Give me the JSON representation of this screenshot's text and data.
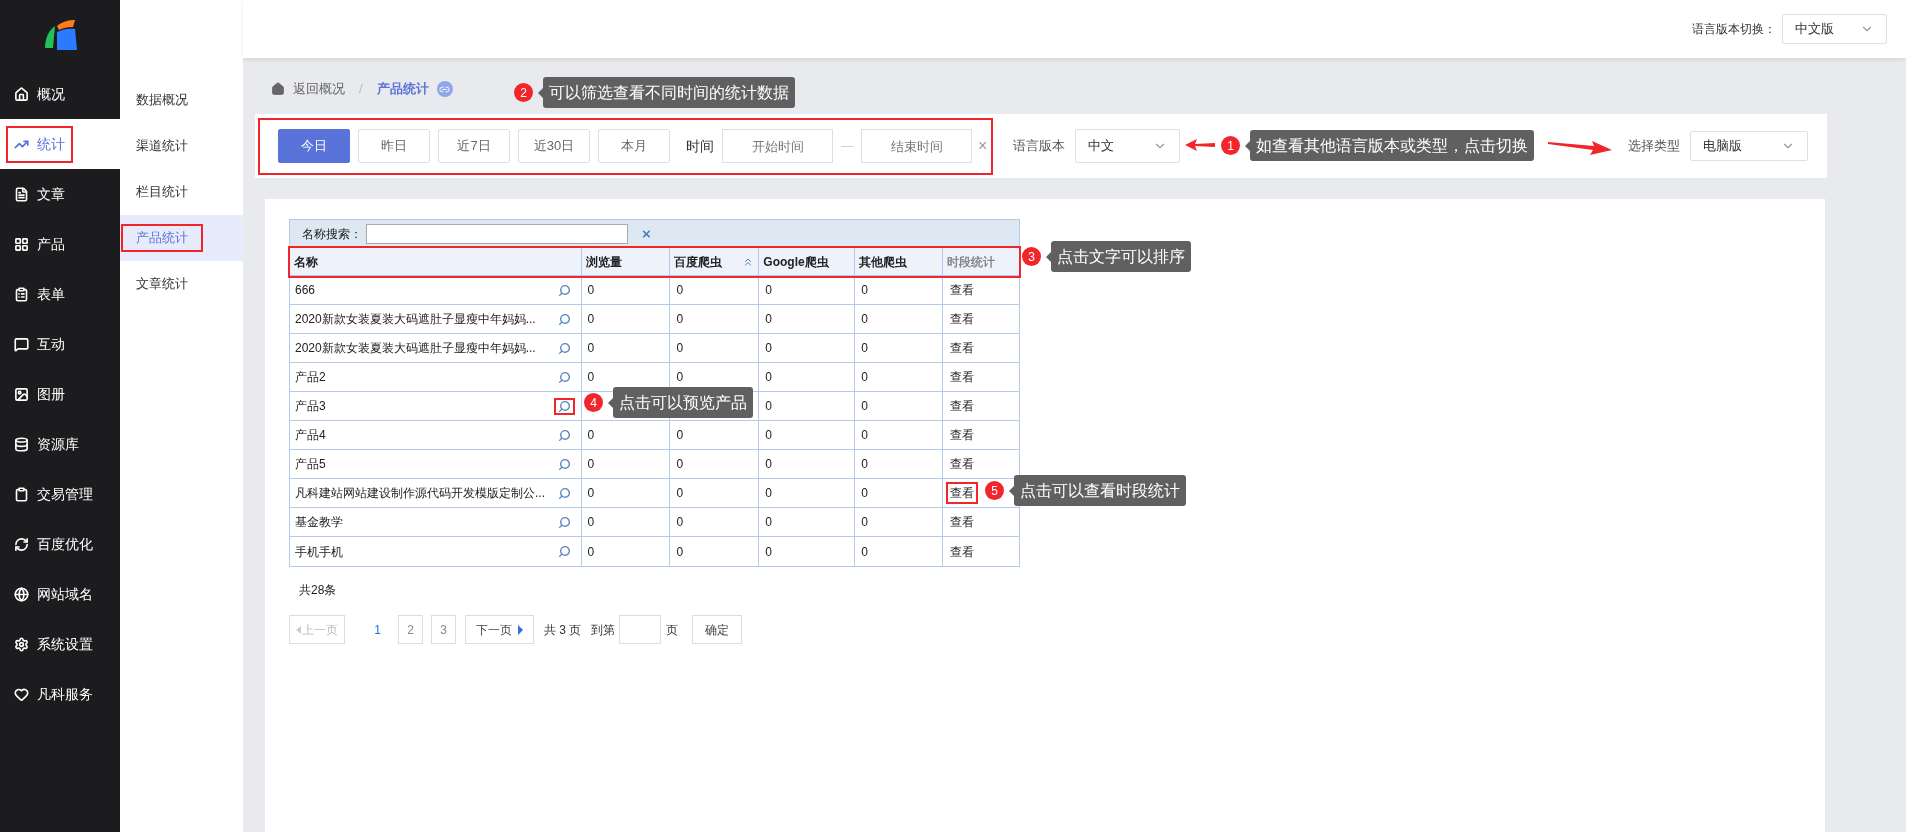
{
  "sidebar": {
    "items": [
      {
        "label": "概况",
        "selected": false,
        "highlighted": false
      },
      {
        "label": "统计",
        "selected": true,
        "highlighted": true
      },
      {
        "label": "文章",
        "selected": false,
        "highlighted": false
      },
      {
        "label": "产品",
        "selected": false,
        "highlighted": false
      },
      {
        "label": "表单",
        "selected": false,
        "highlighted": false
      },
      {
        "label": "互动",
        "selected": false,
        "highlighted": false
      },
      {
        "label": "图册",
        "selected": false,
        "highlighted": false
      },
      {
        "label": "资源库",
        "selected": false,
        "highlighted": false
      },
      {
        "label": "交易管理",
        "selected": false,
        "highlighted": false
      },
      {
        "label": "百度优化",
        "selected": false,
        "highlighted": false
      },
      {
        "label": "网站域名",
        "selected": false,
        "highlighted": false
      },
      {
        "label": "系统设置",
        "selected": false,
        "highlighted": false
      },
      {
        "label": "凡科服务",
        "selected": false,
        "highlighted": false
      }
    ]
  },
  "submenu": {
    "items": [
      {
        "label": "数据概况",
        "selected": false,
        "highlighted": false
      },
      {
        "label": "渠道统计",
        "selected": false,
        "highlighted": false
      },
      {
        "label": "栏目统计",
        "selected": false,
        "highlighted": false
      },
      {
        "label": "产品统计",
        "selected": true,
        "highlighted": true
      },
      {
        "label": "文章统计",
        "selected": false,
        "highlighted": false
      }
    ]
  },
  "header": {
    "language_switch_label": "语言版本切换：",
    "language_switch_value": "中文版"
  },
  "breadcrumb": {
    "back": "返回概况",
    "separator": "/",
    "current": "产品统计"
  },
  "filter_bar": {
    "highlighted": true,
    "ranges": [
      {
        "label": "今日",
        "selected": true
      },
      {
        "label": "昨日",
        "selected": false
      },
      {
        "label": "近7日",
        "selected": false
      },
      {
        "label": "近30日",
        "selected": false
      },
      {
        "label": "本月",
        "selected": false
      }
    ],
    "time_label": "时间",
    "start_placeholder": "开始时间",
    "dash": "—",
    "end_placeholder": "结束时间",
    "clear": "×",
    "language_label": "语言版本",
    "language_value": "中文",
    "type_label": "选择类型",
    "type_value": "电脑版"
  },
  "table": {
    "search_label": "名称搜索：",
    "search_clear": "×",
    "header_highlighted": true,
    "columns": [
      {
        "label": "名称",
        "sortable": true,
        "sorted": false
      },
      {
        "label": "浏览量",
        "sortable": true,
        "sorted": false
      },
      {
        "label": "百度爬虫",
        "sortable": true,
        "sorted": true
      },
      {
        "label": "Google爬虫",
        "sortable": true,
        "sorted": false
      },
      {
        "label": "其他爬虫",
        "sortable": true,
        "sorted": false
      },
      {
        "label": "时段统计",
        "sortable": false,
        "sorted": false
      }
    ],
    "rows": [
      {
        "name": "666",
        "views": "0",
        "baidu": "0",
        "google": "0",
        "other": "0",
        "action": "查看",
        "preview_highlighted": false,
        "action_highlighted": false
      },
      {
        "name": "2020新款女装夏装大码遮肚子显瘦中年妈妈...",
        "views": "0",
        "baidu": "0",
        "google": "0",
        "other": "0",
        "action": "查看",
        "preview_highlighted": false,
        "action_highlighted": false
      },
      {
        "name": "2020新款女装夏装大码遮肚子显瘦中年妈妈...",
        "views": "0",
        "baidu": "0",
        "google": "0",
        "other": "0",
        "action": "查看",
        "preview_highlighted": false,
        "action_highlighted": false
      },
      {
        "name": "产品2",
        "views": "0",
        "baidu": "0",
        "google": "0",
        "other": "0",
        "action": "查看",
        "preview_highlighted": false,
        "action_highlighted": false
      },
      {
        "name": "产品3",
        "google": "0",
        "other": "0",
        "action": "查看",
        "preview_highlighted": true,
        "action_highlighted": false
      },
      {
        "name": "产品4",
        "views": "0",
        "baidu": "0",
        "google": "0",
        "other": "0",
        "action": "查看",
        "preview_highlighted": false,
        "action_highlighted": false
      },
      {
        "name": "产品5",
        "views": "0",
        "baidu": "0",
        "google": "0",
        "other": "0",
        "action": "查看",
        "preview_highlighted": false,
        "action_highlighted": false
      },
      {
        "name": "凡科建站网站建设制作源代码开发模版定制公...",
        "views": "0",
        "baidu": "0",
        "google": "0",
        "other": "0",
        "action": "查看",
        "preview_highlighted": false,
        "action_highlighted": true
      },
      {
        "name": "基金教学",
        "views": "0",
        "baidu": "0",
        "google": "0",
        "other": "0",
        "action": "查看",
        "preview_highlighted": false,
        "action_highlighted": false
      },
      {
        "name": "手机手机",
        "views": "0",
        "baidu": "0",
        "google": "0",
        "other": "0",
        "action": "查看",
        "preview_highlighted": false,
        "action_highlighted": false
      }
    ]
  },
  "pagination": {
    "total": "共28条",
    "prev": "上一页",
    "pages": [
      {
        "label": "1",
        "selected": true
      },
      {
        "label": "2",
        "selected": false
      },
      {
        "label": "3",
        "selected": false
      }
    ],
    "next": "下一页",
    "page_count": "共 3 页",
    "goto": "到第",
    "page_unit": "页",
    "confirm": "确定"
  },
  "callouts": [
    {
      "number": "1",
      "text": "如查看其他语言版本或类型，点击切换"
    },
    {
      "number": "2",
      "text": "可以筛选查看不同时间的统计数据"
    },
    {
      "number": "3",
      "text": "点击文字可以排序"
    },
    {
      "number": "4",
      "text": "点击可以预览产品"
    },
    {
      "number": "5",
      "text": "点击可以查看时段统计"
    }
  ]
}
